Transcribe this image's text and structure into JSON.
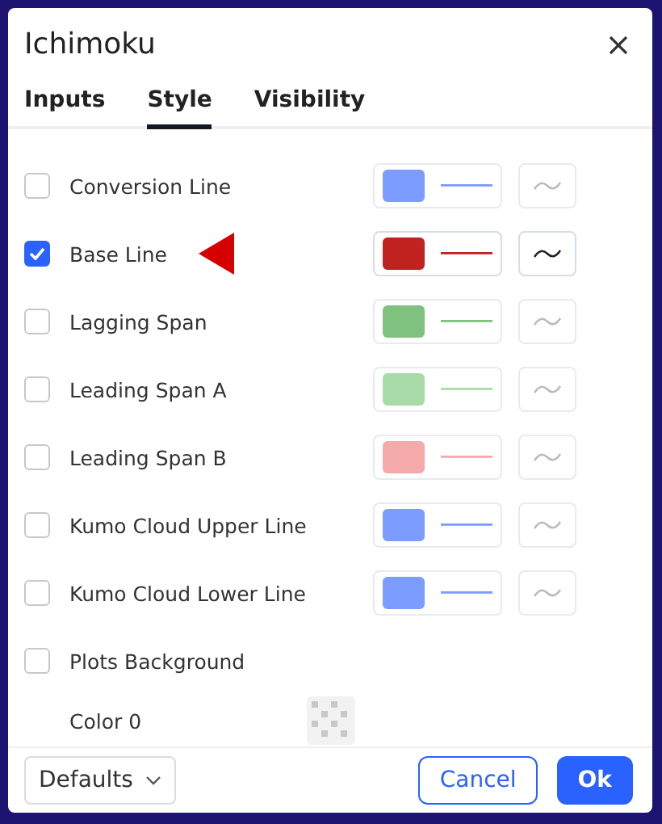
{
  "dialog": {
    "title": "Ichimoku"
  },
  "tabs": [
    {
      "label": "Inputs",
      "selected": false
    },
    {
      "label": "Style",
      "selected": true
    },
    {
      "label": "Visibility",
      "selected": false
    }
  ],
  "rows": [
    {
      "kind": "plot",
      "label": "Conversion Line",
      "checked": false,
      "color": "#7c9cff",
      "pointer": false
    },
    {
      "kind": "plot",
      "label": "Base Line",
      "checked": true,
      "color": "#c0221f",
      "pointer": true
    },
    {
      "kind": "plot",
      "label": "Lagging Span",
      "checked": false,
      "color": "#7fc27f",
      "pointer": false
    },
    {
      "kind": "plot",
      "label": "Leading Span A",
      "checked": false,
      "color": "#a8dba8",
      "pointer": false
    },
    {
      "kind": "plot",
      "label": "Leading Span B",
      "checked": false,
      "color": "#f4aaaa",
      "pointer": false
    },
    {
      "kind": "plot",
      "label": "Kumo Cloud Upper Line",
      "checked": false,
      "color": "#7c9cff",
      "pointer": false
    },
    {
      "kind": "plot",
      "label": "Kumo Cloud Lower Line",
      "checked": false,
      "color": "#7c9cff",
      "pointer": false
    },
    {
      "kind": "toggle",
      "label": "Plots Background",
      "checked": false
    },
    {
      "kind": "color",
      "label": "Color 0"
    }
  ],
  "footer": {
    "preset": "Defaults",
    "cancel": "Cancel",
    "ok": "Ok"
  }
}
